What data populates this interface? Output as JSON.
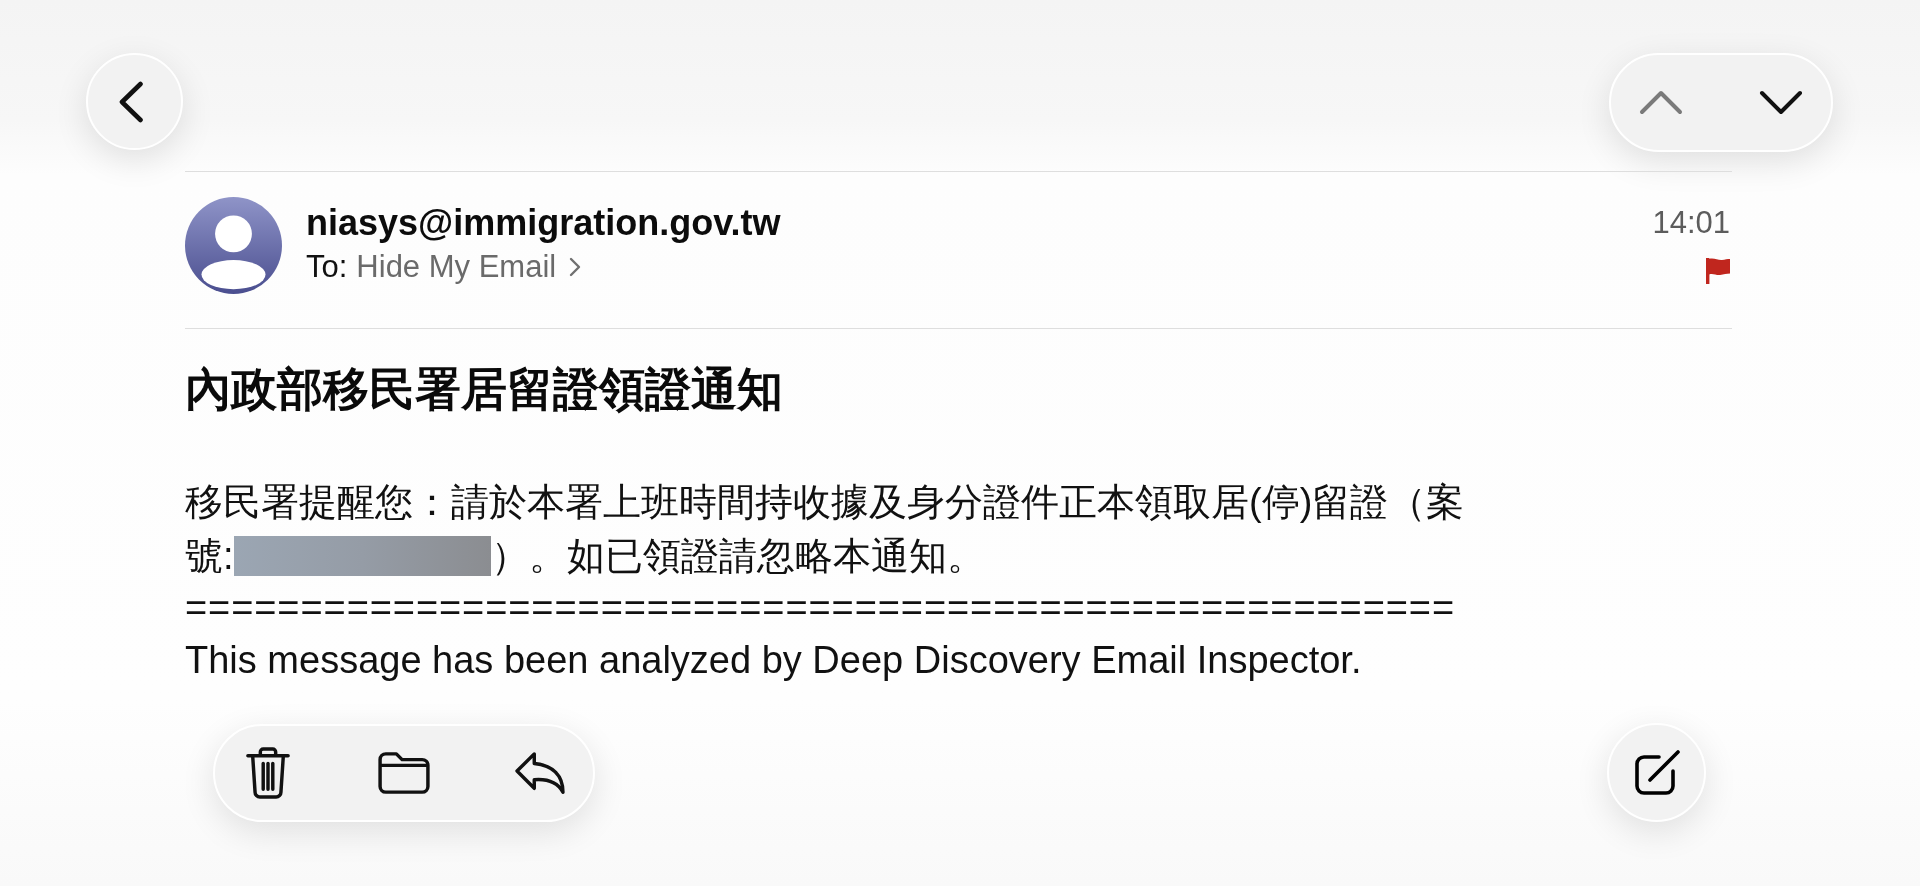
{
  "navigation": {
    "buttons": [
      {
        "kind": "previous",
        "disabled": true
      },
      {
        "kind": "next",
        "disabled": false
      }
    ]
  },
  "header": {
    "sender": "niasys@immigration.gov.tw",
    "to_label": "To:",
    "recipient": "Hide My Email",
    "time": "14:01",
    "flagged": true
  },
  "subject": "內政部移民署居留證領證通知",
  "body": {
    "lines": [
      {
        "segments": [
          {
            "kind": "text",
            "text": "移民署提醒您：請於本署上班時間持收據及身分證件正本領取居(停)留證（案"
          }
        ]
      },
      {
        "segments": [
          {
            "kind": "text",
            "text": "號:"
          },
          {
            "kind": "redacted"
          },
          {
            "kind": "text",
            "text": "）。如已領證請忽略本通知。"
          }
        ]
      }
    ],
    "separator": "=======================================================",
    "footer": "This message has been analyzed by Deep Discovery Email Inspector."
  }
}
